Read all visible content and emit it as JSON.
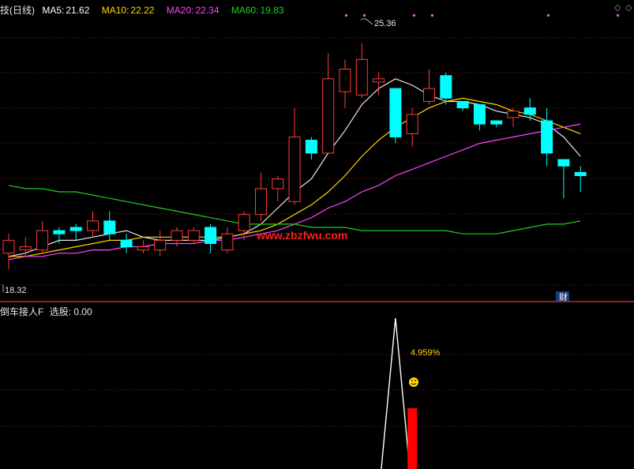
{
  "header": {
    "stock_title": "技(日线)",
    "ma5": {
      "label": "MA5:",
      "value": "21.62",
      "color": "#ffffff"
    },
    "ma10": {
      "label": "MA10:",
      "value": "22.22",
      "color": "#ffd700"
    },
    "ma20": {
      "label": "MA20:",
      "value": "22.34",
      "color": "#ff44ff"
    },
    "ma60": {
      "label": "MA60:",
      "value": "19.83",
      "color": "#22cc22"
    },
    "nav_left_icon": "diamond-left-icon",
    "nav_right_icon": "diamond-right-icon"
  },
  "sub_header": {
    "indicator_name": "倒车接人F",
    "select_label": "选股:",
    "select_value": "0.00"
  },
  "annotations": {
    "high_price": "25.36",
    "low_price": "18.32",
    "watermark": "www.zbzfwu.com",
    "finance_badge": "财",
    "percent_label": "4.959%",
    "smiley_icon": "smiley-icon"
  },
  "chart_data": {
    "type": "candlestick",
    "price_range": [
      17.5,
      26.3
    ],
    "bullish_color": "#ff3b3b",
    "bearish_color": "#00ffff",
    "candles": [
      {
        "o": 18.9,
        "h": 19.5,
        "l": 18.4,
        "c": 19.3
      },
      {
        "o": 19.0,
        "h": 19.4,
        "l": 18.8,
        "c": 19.1
      },
      {
        "o": 19.0,
        "h": 19.9,
        "l": 18.9,
        "c": 19.6
      },
      {
        "o": 19.6,
        "h": 19.7,
        "l": 19.2,
        "c": 19.5
      },
      {
        "o": 19.7,
        "h": 19.8,
        "l": 19.3,
        "c": 19.6
      },
      {
        "o": 19.6,
        "h": 20.2,
        "l": 19.4,
        "c": 19.9
      },
      {
        "o": 19.9,
        "h": 20.2,
        "l": 19.3,
        "c": 19.5
      },
      {
        "o": 19.3,
        "h": 19.5,
        "l": 18.9,
        "c": 19.1
      },
      {
        "o": 19.0,
        "h": 19.3,
        "l": 18.9,
        "c": 19.1
      },
      {
        "o": 19.0,
        "h": 19.6,
        "l": 18.8,
        "c": 19.3
      },
      {
        "o": 19.3,
        "h": 19.7,
        "l": 19.1,
        "c": 19.6
      },
      {
        "o": 19.3,
        "h": 19.7,
        "l": 19.2,
        "c": 19.6
      },
      {
        "o": 19.7,
        "h": 19.8,
        "l": 18.9,
        "c": 19.2
      },
      {
        "o": 19.0,
        "h": 19.7,
        "l": 18.9,
        "c": 19.5
      },
      {
        "o": 19.6,
        "h": 20.2,
        "l": 19.3,
        "c": 20.1
      },
      {
        "o": 20.1,
        "h": 21.4,
        "l": 19.9,
        "c": 20.9
      },
      {
        "o": 20.9,
        "h": 21.3,
        "l": 20.5,
        "c": 21.2
      },
      {
        "o": 20.5,
        "h": 23.4,
        "l": 20.4,
        "c": 22.5
      },
      {
        "o": 22.4,
        "h": 22.5,
        "l": 21.8,
        "c": 22.0
      },
      {
        "o": 22.0,
        "h": 25.1,
        "l": 22.0,
        "c": 24.3
      },
      {
        "o": 23.9,
        "h": 24.9,
        "l": 23.4,
        "c": 24.6
      },
      {
        "o": 23.8,
        "h": 25.4,
        "l": 23.7,
        "c": 24.9
      },
      {
        "o": 24.2,
        "h": 24.5,
        "l": 23.8,
        "c": 24.3
      },
      {
        "o": 24.0,
        "h": 24.0,
        "l": 22.3,
        "c": 22.5
      },
      {
        "o": 22.6,
        "h": 23.4,
        "l": 22.2,
        "c": 23.2
      },
      {
        "o": 23.6,
        "h": 24.6,
        "l": 23.5,
        "c": 24.0
      },
      {
        "o": 24.4,
        "h": 24.5,
        "l": 23.5,
        "c": 23.7
      },
      {
        "o": 23.6,
        "h": 23.6,
        "l": 23.3,
        "c": 23.4
      },
      {
        "o": 23.5,
        "h": 23.5,
        "l": 22.7,
        "c": 22.9
      },
      {
        "o": 23.0,
        "h": 23.0,
        "l": 22.8,
        "c": 22.9
      },
      {
        "o": 23.1,
        "h": 23.4,
        "l": 22.8,
        "c": 23.3
      },
      {
        "o": 23.4,
        "h": 23.7,
        "l": 23.0,
        "c": 23.2
      },
      {
        "o": 23.0,
        "h": 23.4,
        "l": 21.6,
        "c": 22.0
      },
      {
        "o": 21.8,
        "h": 21.8,
        "l": 20.6,
        "c": 21.6
      },
      {
        "o": 21.4,
        "h": 21.6,
        "l": 20.8,
        "c": 21.3
      }
    ],
    "moving_averages": [
      {
        "name": "MA5",
        "color": "#e8e8e8",
        "values": [
          18.8,
          18.9,
          19.1,
          19.3,
          19.3,
          19.4,
          19.5,
          19.6,
          19.4,
          19.3,
          19.3,
          19.3,
          19.3,
          19.4,
          19.5,
          19.8,
          20.3,
          20.8,
          21.2,
          22.0,
          22.7,
          23.5,
          24.0,
          24.3,
          24.1,
          23.8,
          23.6,
          23.6,
          23.5,
          23.3,
          23.2,
          23.1,
          22.9,
          22.5,
          21.9
        ]
      },
      {
        "name": "MA10",
        "color": "#ffd700",
        "values": [
          18.8,
          18.8,
          18.9,
          19.0,
          19.1,
          19.2,
          19.3,
          19.3,
          19.4,
          19.4,
          19.4,
          19.4,
          19.4,
          19.4,
          19.5,
          19.6,
          19.8,
          20.1,
          20.4,
          20.8,
          21.3,
          21.9,
          22.4,
          22.8,
          23.1,
          23.4,
          23.6,
          23.7,
          23.6,
          23.5,
          23.3,
          23.2,
          23.0,
          22.8,
          22.6
        ]
      },
      {
        "name": "MA20",
        "color": "#ff44ff",
        "values": [
          18.7,
          18.8,
          18.8,
          18.9,
          18.9,
          19.0,
          19.0,
          19.1,
          19.1,
          19.2,
          19.2,
          19.2,
          19.3,
          19.3,
          19.4,
          19.5,
          19.6,
          19.8,
          20.0,
          20.3,
          20.5,
          20.8,
          21.0,
          21.3,
          21.5,
          21.7,
          21.9,
          22.1,
          22.3,
          22.4,
          22.5,
          22.6,
          22.7,
          22.8,
          22.9
        ]
      },
      {
        "name": "MA60",
        "color": "#22cc22",
        "values": [
          21.0,
          20.9,
          20.9,
          20.8,
          20.8,
          20.7,
          20.6,
          20.5,
          20.4,
          20.3,
          20.2,
          20.1,
          20.0,
          19.9,
          19.8,
          19.8,
          19.8,
          19.8,
          19.7,
          19.7,
          19.7,
          19.6,
          19.6,
          19.6,
          19.6,
          19.6,
          19.6,
          19.5,
          19.5,
          19.5,
          19.6,
          19.7,
          19.8,
          19.8,
          19.9
        ]
      }
    ],
    "indicator": {
      "name": "倒车接人F",
      "signal_bar_index": 24,
      "signal_bar_color": "#ff0000",
      "spike_index": 23,
      "spike_color": "#ffffff"
    }
  }
}
